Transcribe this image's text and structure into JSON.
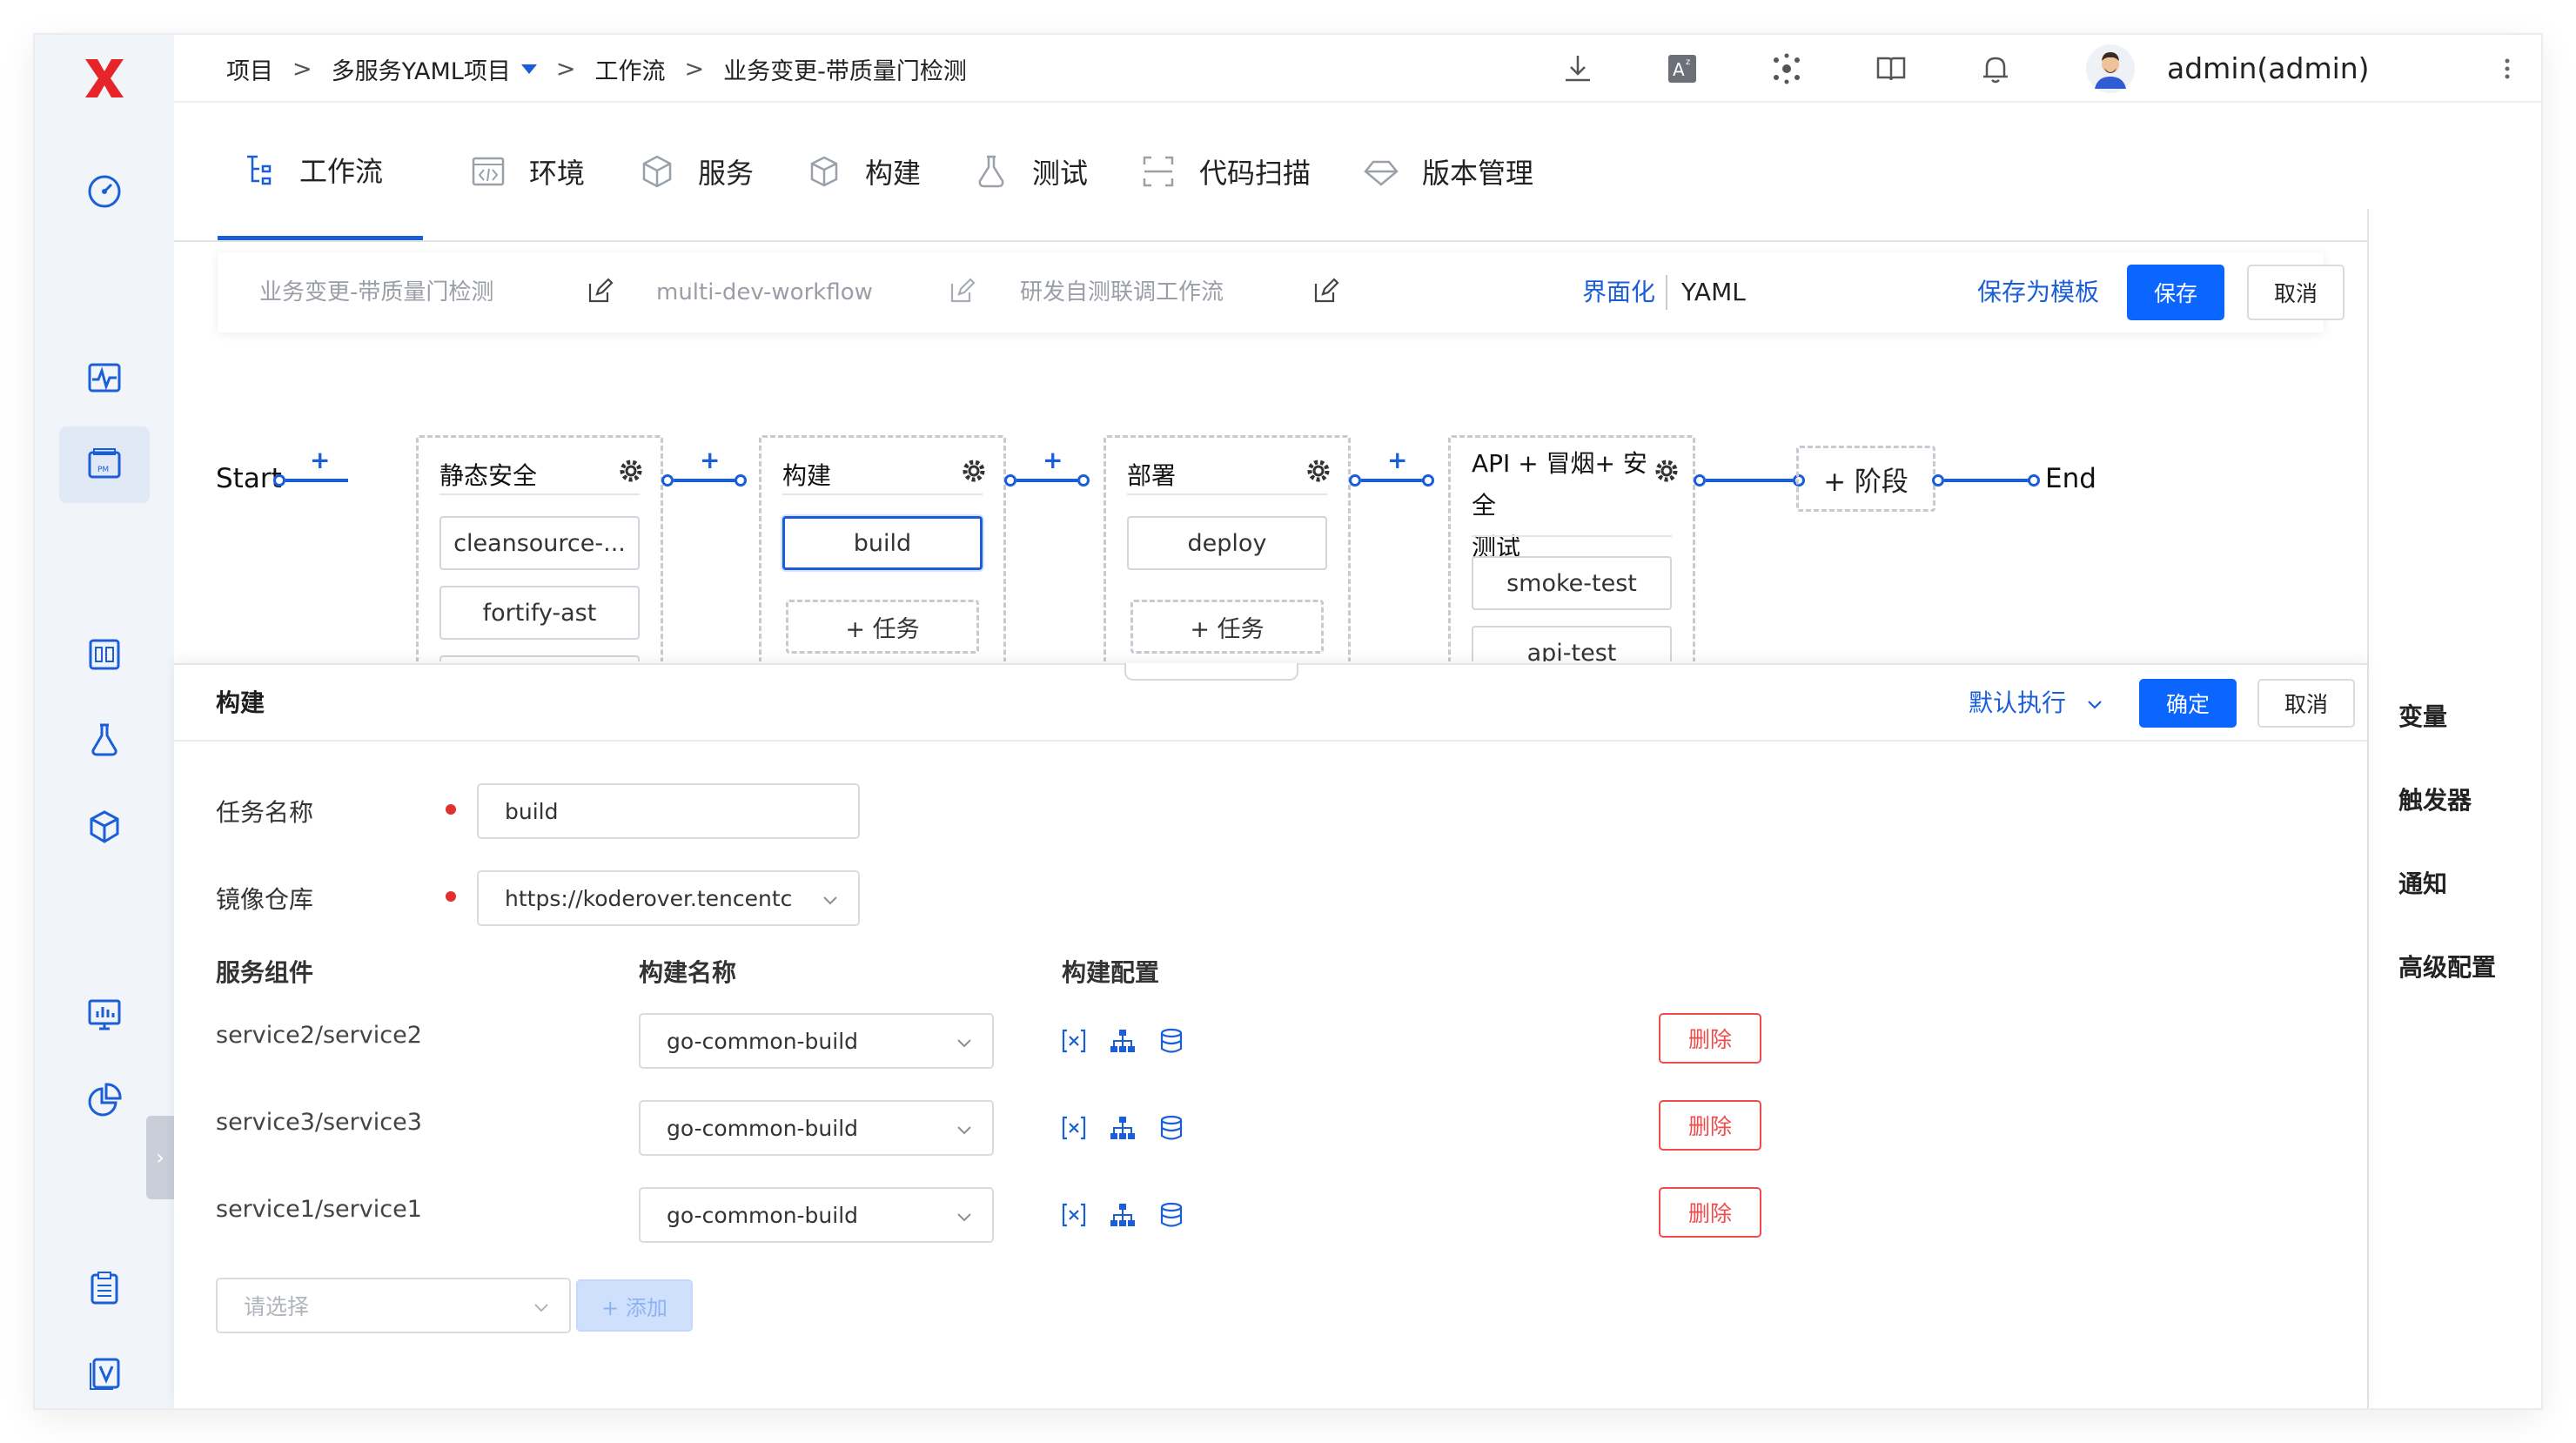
{
  "breadcrumb": {
    "project": "项目",
    "sep1": ">",
    "project_name": "多服务YAML项目",
    "sep2": ">",
    "section": "工作流",
    "sep3": ">",
    "workflow": "业务变更-带质量门检测"
  },
  "user": {
    "name": "admin(admin)"
  },
  "header_icons": [
    "download-icon",
    "translate-icon",
    "cluster-icon",
    "book-icon",
    "bell-icon",
    "more-icon"
  ],
  "tabs": [
    {
      "label": "工作流",
      "icon": "workflow-icon"
    },
    {
      "label": "环境",
      "icon": "code-icon"
    },
    {
      "label": "服务",
      "icon": "service-icon"
    },
    {
      "label": "构建",
      "icon": "cube-icon"
    },
    {
      "label": "测试",
      "icon": "flask-icon"
    },
    {
      "label": "代码扫描",
      "icon": "scan-icon"
    },
    {
      "label": "版本管理",
      "icon": "version-icon"
    }
  ],
  "toolbar": {
    "display_name": "业务变更-带质量门检测",
    "identifier": "multi-dev-workflow",
    "description": "研发自测联调工作流",
    "view_ui": "界面化",
    "view_yaml": "YAML",
    "save_template": "保存为模板",
    "save": "保存",
    "cancel": "取消"
  },
  "pipeline": {
    "start": "Start",
    "end": "End",
    "plus": "+",
    "add_stage": "+ 阶段",
    "add_job": "+ 任务",
    "stages": [
      {
        "title": "静态安全",
        "jobs": [
          "cleansource-...",
          "fortify-ast"
        ]
      },
      {
        "title": "构建",
        "jobs": [
          "build"
        ]
      },
      {
        "title": "部署",
        "jobs": [
          "deploy"
        ]
      },
      {
        "title_line1": "API + 冒烟+ 安全",
        "title_line2": "测试",
        "jobs": [
          "smoke-test",
          "api-test"
        ]
      }
    ]
  },
  "job_panel": {
    "title": "构建",
    "exec_mode": "默认执行",
    "confirm": "确定",
    "cancel": "取消",
    "task_name_label": "任务名称",
    "task_name_value": "build",
    "registry_label": "镜像仓库",
    "registry_value": "https://koderover.tencentc",
    "columns": [
      "服务组件",
      "构建名称",
      "构建配置"
    ],
    "rows": [
      {
        "service": "service2/service2",
        "build": "go-common-build",
        "delete": "删除"
      },
      {
        "service": "service3/service3",
        "build": "go-common-build",
        "delete": "删除"
      },
      {
        "service": "service1/service1",
        "build": "go-common-build",
        "delete": "删除"
      }
    ],
    "select_placeholder": "请选择",
    "add_label": "+ 添加"
  },
  "right_panel": [
    "变量",
    "触发器",
    "通知",
    "高级配置"
  ],
  "colors": {
    "primary": "#0a66ff",
    "accent": "#1a5fd8",
    "danger": "#f04b4b",
    "sidebar": "#f1f4f9"
  }
}
